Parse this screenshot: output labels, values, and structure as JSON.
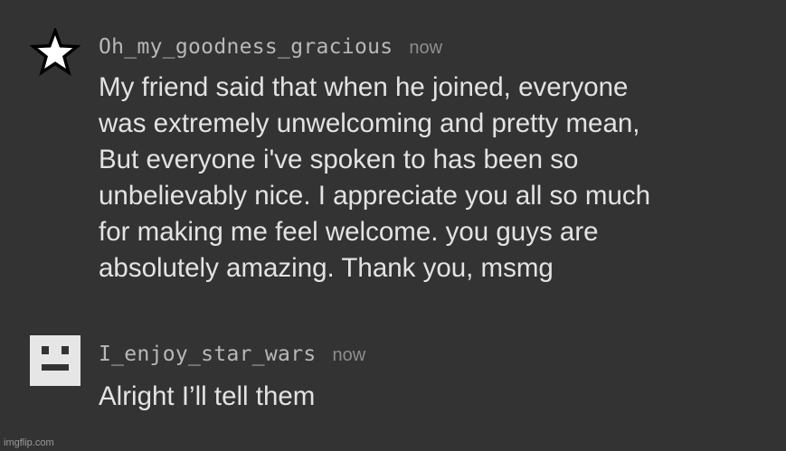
{
  "comments": [
    {
      "avatar_icon": "star-icon",
      "username": "Oh_my_goodness_gracious",
      "time": "now",
      "text": "My friend said that when he joined, everyone\nwas extremely unwelcoming and pretty mean,\nBut everyone i've spoken to has been so\nunbelievably nice. I appreciate you all so much\nfor making me feel welcome. you guys are\nabsolutely amazing. Thank you, msmg"
    },
    {
      "avatar_icon": "robot-face-icon",
      "username": "I_enjoy_star_wars",
      "time": "now",
      "text": "Alright I’ll tell them"
    }
  ],
  "watermark": "imgflip.com",
  "colors": {
    "background": "#333333",
    "username": "#b8b8b8",
    "timestamp": "#8e8e8e",
    "body_text": "#e3e3e3",
    "avatar_face": "#e6e6e6"
  }
}
